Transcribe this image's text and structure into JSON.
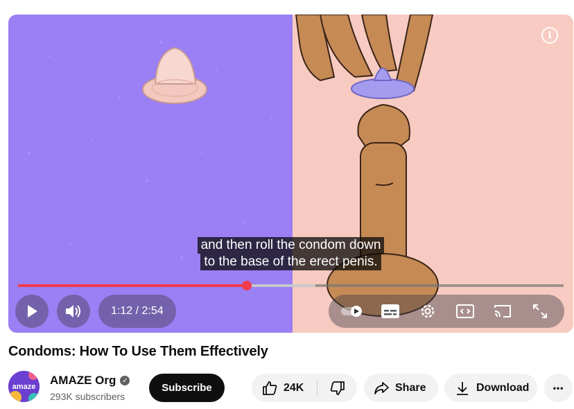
{
  "video": {
    "caption_lines": [
      "and then roll the condom down",
      "to the base of the erect penis."
    ],
    "current_time": "1:12",
    "duration": "2:54",
    "time_display": "1:12 / 2:54",
    "progress_fraction": 0.419,
    "buffered_fraction": 0.545,
    "scene_colors": {
      "left_background": "#9b7ff5",
      "right_background": "#f7cbc1",
      "skin": "#c68a55",
      "condom_ring": "#9f96ee",
      "condom_package": "#f3c8bf"
    },
    "controls": {
      "play_icon": "play-icon",
      "volume_icon": "volume-icon",
      "info_icon": "info-icon",
      "info_glyph": "i",
      "right_icons": [
        "autoplay-toggle-icon",
        "subtitles-icon",
        "settings-icon",
        "miniplayer-icon",
        "cast-icon",
        "fullscreen-icon"
      ]
    },
    "accent_color": "#f03c4e"
  },
  "title": "Condoms: How To Use Them Effectively",
  "channel": {
    "name": "AMAZE Org",
    "subscribers": "293K subscribers",
    "avatar_text": "amaze",
    "verified_glyph": "✓"
  },
  "actions": {
    "subscribe_label": "Subscribe",
    "like_count": "24K",
    "share_label": "Share",
    "download_label": "Download",
    "more_label": "•••"
  }
}
